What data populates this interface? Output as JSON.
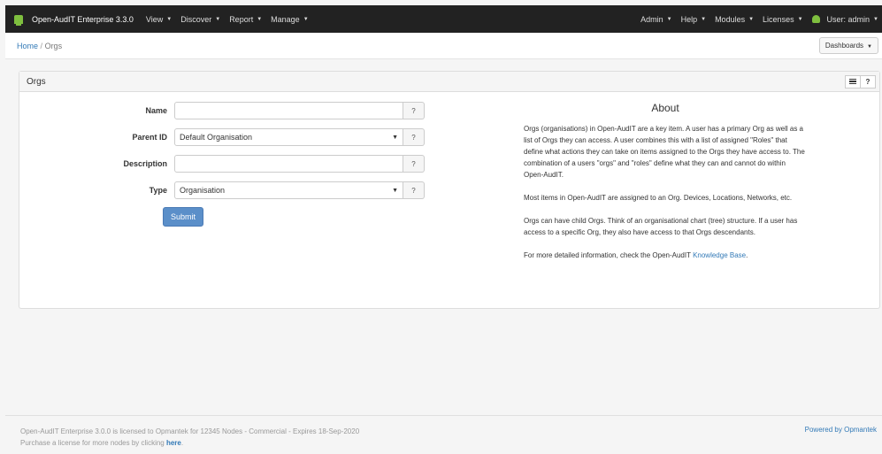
{
  "nav": {
    "brand": "Open-AudIT Enterprise 3.3.0",
    "left_items": [
      "View",
      "Discover",
      "Report",
      "Manage"
    ],
    "right_items": [
      "Admin",
      "Help",
      "Modules",
      "Licenses"
    ],
    "user": "User: admin"
  },
  "breadcrumb": {
    "home": "Home",
    "separator": "/",
    "current": "Orgs"
  },
  "dashboards_label": "Dashboards",
  "panel": {
    "title": "Orgs",
    "help_label": "?"
  },
  "form": {
    "name_label": "Name",
    "name_value": "",
    "parent_label": "Parent ID",
    "parent_value": "Default Organisation",
    "description_label": "Description",
    "description_value": "",
    "type_label": "Type",
    "type_value": "Organisation",
    "help_glyph": "?",
    "submit_label": "Submit"
  },
  "about": {
    "title": "About",
    "p1": "Orgs (organisations) in Open-AudIT are a key item. A user has a primary Org as well as a list of Orgs they can access. A user combines this with a list of assigned \"Roles\" that define what actions they can take on items assigned to the Orgs they have access to. The combination of a users \"orgs\" and \"roles\" define what they can and cannot do within Open-AudIT.",
    "p2": "Most items in Open-AudIT are assigned to an Org. Devices, Locations, Networks, etc.",
    "p3": "Orgs can have child Orgs. Think of an organisational chart (tree) structure. If a user has access to a specific Org, they also have access to that Orgs descendants.",
    "p4_prefix": "For more detailed information, check the Open-AudIT ",
    "p4_link": "Knowledge Base",
    "p4_suffix": "."
  },
  "footer": {
    "line1": "Open-AudIT Enterprise 3.0.0 is licensed to Opmantek for 12345 Nodes - Commercial - Expires 18-Sep-2020",
    "line2_prefix": "Purchase a license for more nodes by clicking ",
    "line2_link": "here",
    "line2_suffix": ".",
    "powered": "Powered by Opmantek"
  },
  "colors": {
    "accent": "#337ab7",
    "submit": "#5b8fc9",
    "navbar": "#222222",
    "brand_icon": "#7fbf3f"
  }
}
